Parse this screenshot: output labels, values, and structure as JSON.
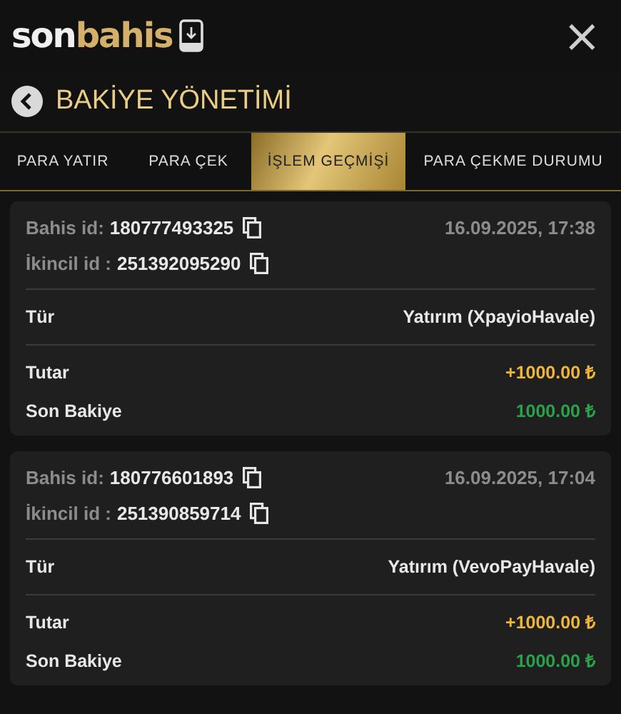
{
  "header": {
    "logo": [
      {
        "text": "son",
        "color": "#f0f0f0"
      },
      {
        "text": "bahis",
        "color": "#d4b06a"
      }
    ],
    "close": "×"
  },
  "title": "BAKİYE YÖNETİMİ",
  "tabs": [
    {
      "label": "PARA YATIR",
      "selected": false
    },
    {
      "label": "PARA ÇEK",
      "selected": false
    },
    {
      "label": "İŞLEM GEÇMİŞİ",
      "selected": true
    },
    {
      "label": "PARA ÇEKME DURUMU",
      "selected": false
    }
  ],
  "transactions": [
    {
      "bet_label": "Bahis id:",
      "bet_id": "180777493325",
      "date": "16.09.2025, 17:38",
      "secondary_label": "İkincil id :",
      "secondary_id": "251392095290",
      "type_label": "Tür",
      "type": "Yatırım (XpayioHavale)",
      "amount_label": "Tutar",
      "amount": "+1000.00 ₺",
      "balance_label": "Son Bakiye",
      "balance": "1000.00 ₺"
    },
    {
      "bet_label": "Bahis id:",
      "bet_id": "180776601893",
      "date": "16.09.2025, 17:04",
      "secondary_label": "İkincil id :",
      "secondary_id": "251390859714",
      "type_label": "Tür",
      "type": "Yatırım (VevoPayHavale)",
      "amount_label": "Tutar",
      "amount": "+1000.00 ₺",
      "balance_label": "Son Bakiye",
      "balance": "1000.00 ₺"
    }
  ]
}
